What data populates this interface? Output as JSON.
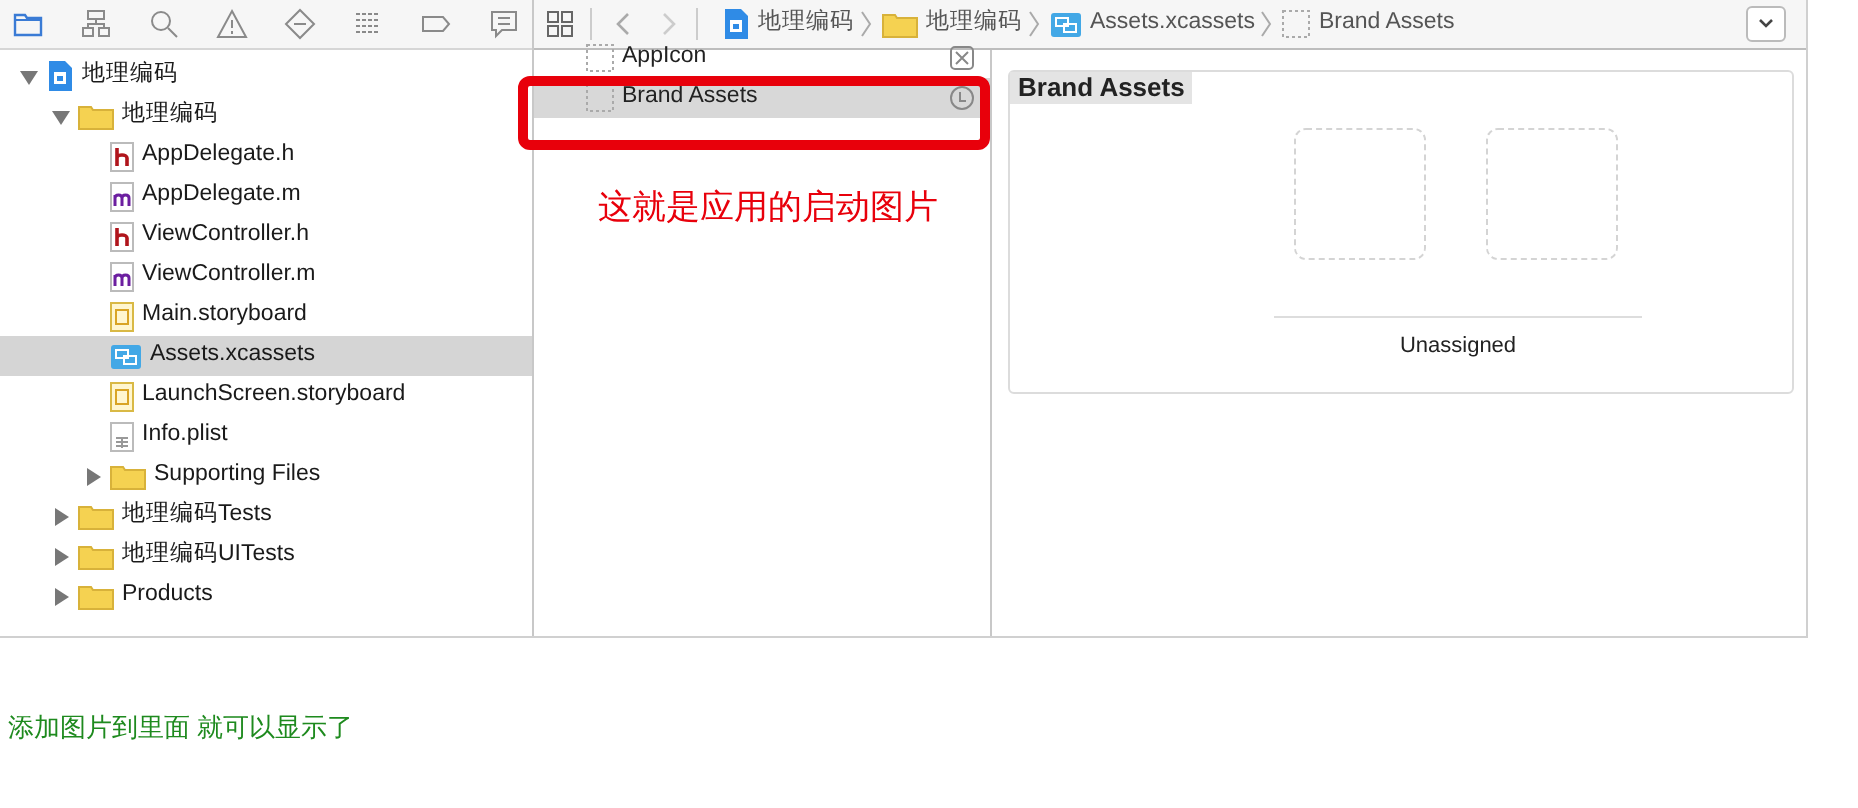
{
  "navigator_tabs": [
    {
      "kind": "folder",
      "selected": true
    },
    {
      "kind": "hierarchy",
      "selected": false
    },
    {
      "kind": "search",
      "selected": false
    },
    {
      "kind": "warning",
      "selected": false
    },
    {
      "kind": "diamond",
      "selected": false
    },
    {
      "kind": "list",
      "selected": false
    },
    {
      "kind": "tag",
      "selected": false
    },
    {
      "kind": "bubble",
      "selected": false
    }
  ],
  "tree": [
    {
      "label": "地理编码",
      "kind": "project",
      "expanded": true,
      "selected": false,
      "children": [
        {
          "label": "地理编码",
          "kind": "folder",
          "expanded": true,
          "selected": false,
          "children": [
            {
              "label": "AppDelegate.h",
              "kind": "h",
              "selected": false
            },
            {
              "label": "AppDelegate.m",
              "kind": "m",
              "selected": false
            },
            {
              "label": "ViewController.h",
              "kind": "h",
              "selected": false
            },
            {
              "label": "ViewController.m",
              "kind": "m",
              "selected": false
            },
            {
              "label": "Main.storyboard",
              "kind": "storyboard",
              "selected": false
            },
            {
              "label": "Assets.xcassets",
              "kind": "xcassets",
              "selected": true
            },
            {
              "label": "LaunchScreen.storyboard",
              "kind": "storyboard",
              "selected": false
            },
            {
              "label": "Info.plist",
              "kind": "plist",
              "selected": false
            },
            {
              "label": "Supporting Files",
              "kind": "folder",
              "expanded": false,
              "selected": false
            }
          ]
        },
        {
          "label": "地理编码Tests",
          "kind": "folder",
          "expanded": false,
          "selected": false
        },
        {
          "label": "地理编码UITests",
          "kind": "folder",
          "expanded": false,
          "selected": false
        },
        {
          "label": "Products",
          "kind": "folder",
          "expanded": false,
          "selected": false
        }
      ]
    }
  ],
  "breadcrumb": [
    {
      "label": "地理编码",
      "kind": "project"
    },
    {
      "label": "地理编码",
      "kind": "folder"
    },
    {
      "label": "Assets.xcassets",
      "kind": "xcassets"
    },
    {
      "label": "Brand Assets",
      "kind": "asset"
    }
  ],
  "asset_list": [
    {
      "label": "AppIcon",
      "kind": "appicon",
      "selected": false
    },
    {
      "label": "Brand Assets",
      "kind": "launch",
      "selected": true
    }
  ],
  "annotation": "这就是应用的启动图片",
  "detail": {
    "title": "Brand Assets",
    "slot_label": "Unassigned"
  },
  "caption": "添加图片到里面 就可以显示了"
}
